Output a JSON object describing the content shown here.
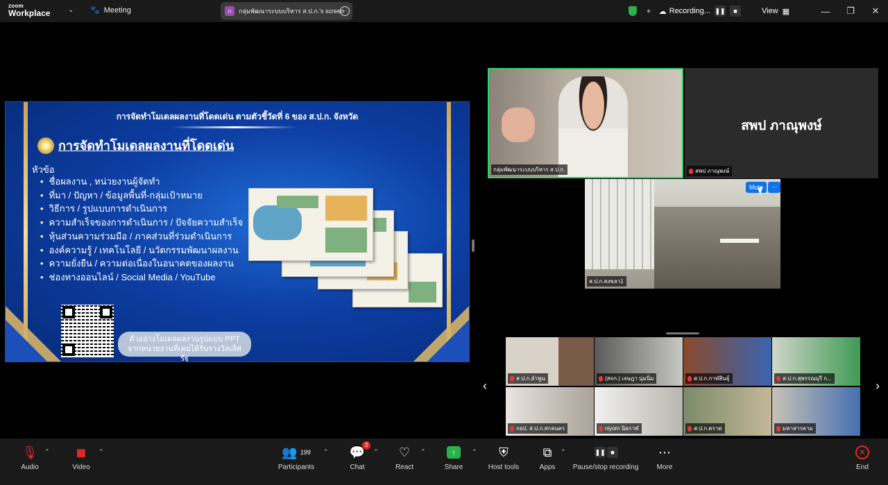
{
  "app": {
    "logo_top": "zoom",
    "logo_bottom": "Workplace",
    "meeting_label": "Meeting"
  },
  "share_pill": {
    "avatar": "ก",
    "text": "กลุ่มพัฒนาระบบบริหาร ส.ป.ก.'s screen"
  },
  "top_right": {
    "recording": "Recording...",
    "view": "View"
  },
  "slide": {
    "title": "การจัดทำโมเดลผลงานที่โดดเด่น ตามตัวชี้วัดที่ 6 ของ ส.ป.ก. จังหวัด",
    "heading": "การจัดทำโมเดลผลงานที่โดดเด่น",
    "topic_label": "หัวข้อ",
    "bullets": [
      "ชื่อผลงาน , หน่วยงานผู้จัดทำ",
      "ที่มา / ปัญหา / ข้อมูลพื้นที่-กลุ่มเป้าหมาย",
      "วิธีการ / รูปแบบการดำเนินการ",
      "ความสำเร็จของการดำเนินการ / ปัจจัยความสำเร็จ",
      "หุ้นส่วนความร่วมมือ / ภาคส่วนที่ร่วมดำเนินการ",
      "องค์ความรู้ / เทคโนโลยี / นวัตกรรมพัฒนาผลงาน",
      "ความยั่งยืน / ความต่อเนื่องในอนาคตของผลงาน",
      "ช่องทางออนไลน์ / Social Media / YouTube"
    ],
    "caption_line1": "ตัวอย่างโมเดลผลงานรูปแบบ PPT",
    "caption_line2": "จากหน่วยงานที่เคยได้รับรางวัลเลิศรัฐ"
  },
  "videos": {
    "main_speaker": "กลุ่มพัฒนาระบบบริหาร ส.ป.ก.",
    "tile2_big": "สพป ภาณุพงษ์",
    "tile2_name": "สพป ภาณุพงษ์",
    "tile3_name": "ส.ป.ก.สงขลา1",
    "mute_label": "Mute",
    "more_label": "···"
  },
  "gallery": [
    "ส.ป.ก.ลำพูน",
    "(สจก.) เจษฎา นุ่มนิ่ม",
    "ส.ป.ก.กาฬสินธุ์",
    "ส.ป.ก.สุพรรณบุรี ก...",
    "กยป. ส.ป.ก.สกลนคร",
    "niyom นิยกาฬ",
    "ส.ป.ก.ตราด",
    "มหาสารคาม"
  ],
  "toolbar": {
    "audio": "Audio",
    "video": "Video",
    "participants": "Participants",
    "participants_count": "199",
    "chat": "Chat",
    "chat_badge": "2",
    "react": "React",
    "share": "Share",
    "host_tools": "Host tools",
    "apps": "Apps",
    "pause_stop": "Pause/stop recording",
    "more": "More",
    "end": "End"
  },
  "colors": {
    "active_speaker": "#33d16b",
    "accent": "#0e72ed",
    "share": "#2bb14b",
    "end": "#e02828"
  }
}
